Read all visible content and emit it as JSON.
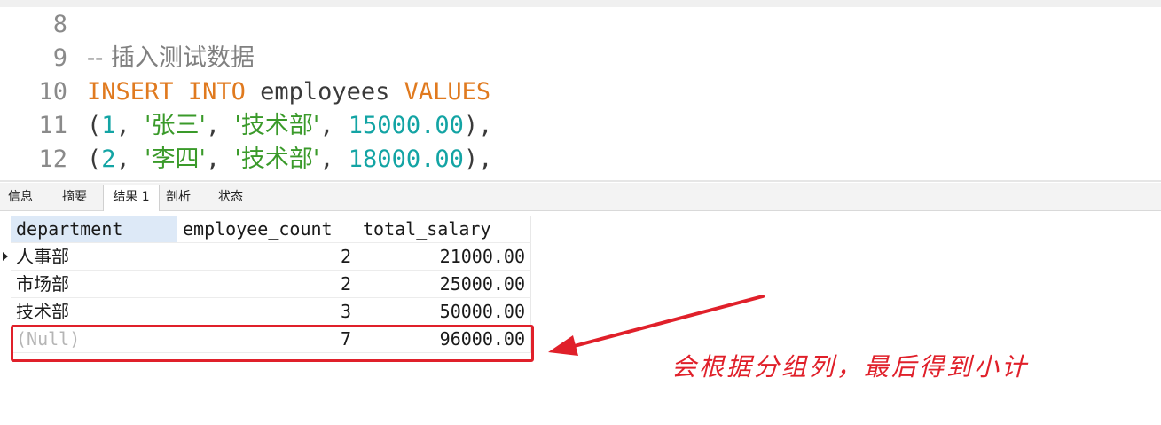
{
  "editor": {
    "lines": [
      {
        "num": "8",
        "parts": []
      },
      {
        "num": "9",
        "parts": [
          {
            "t": "-- 插入测试数据",
            "c": "cm"
          }
        ]
      },
      {
        "num": "10",
        "parts": [
          {
            "t": "INSERT",
            "c": "kw"
          },
          {
            "t": " ",
            "c": "id"
          },
          {
            "t": "INTO",
            "c": "kw"
          },
          {
            "t": " employees ",
            "c": "id"
          },
          {
            "t": "VALUES",
            "c": "kw"
          }
        ]
      },
      {
        "num": "11",
        "parts": [
          {
            "t": "(",
            "c": "pun"
          },
          {
            "t": "1",
            "c": "num"
          },
          {
            "t": ", ",
            "c": "pun"
          },
          {
            "t": "'张三'",
            "c": "str"
          },
          {
            "t": ", ",
            "c": "pun"
          },
          {
            "t": "'技术部'",
            "c": "str"
          },
          {
            "t": ", ",
            "c": "pun"
          },
          {
            "t": "15000.00",
            "c": "num"
          },
          {
            "t": "),",
            "c": "pun"
          }
        ]
      },
      {
        "num": "12",
        "parts": [
          {
            "t": "(",
            "c": "pun"
          },
          {
            "t": "2",
            "c": "num"
          },
          {
            "t": ", ",
            "c": "pun"
          },
          {
            "t": "'李四'",
            "c": "str"
          },
          {
            "t": ", ",
            "c": "pun"
          },
          {
            "t": "'技术部'",
            "c": "str"
          },
          {
            "t": ", ",
            "c": "pun"
          },
          {
            "t": "18000.00",
            "c": "num"
          },
          {
            "t": "),",
            "c": "pun"
          }
        ]
      }
    ]
  },
  "tabs": [
    {
      "label": "信息",
      "active": false
    },
    {
      "label": "摘要",
      "active": false
    },
    {
      "label": "结果 1",
      "active": true
    },
    {
      "label": "剖析",
      "active": false
    },
    {
      "label": "状态",
      "active": false
    }
  ],
  "grid": {
    "columns": [
      "department",
      "employee_count",
      "total_salary"
    ],
    "rows": [
      [
        "人事部",
        "2",
        "21000.00"
      ],
      [
        "市场部",
        "2",
        "25000.00"
      ],
      [
        "技术部",
        "3",
        "50000.00"
      ],
      [
        "(Null)",
        "7",
        "96000.00"
      ]
    ]
  },
  "annotation": {
    "text": "会根据分组列，最后得到小计",
    "color": "#e0202a"
  }
}
